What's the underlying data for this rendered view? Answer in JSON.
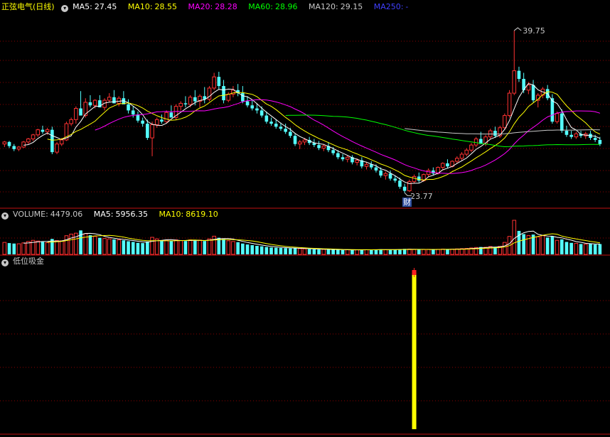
{
  "price": {
    "stock_name": "正弦电气",
    "period": "(日线)",
    "ma": [
      {
        "label": "MA5:",
        "value": "27.45",
        "color": "#ffffff"
      },
      {
        "label": "MA10:",
        "value": "28.55",
        "color": "#ffff00"
      },
      {
        "label": "MA20:",
        "value": "28.28",
        "color": "#ff00ff"
      },
      {
        "label": "MA60:",
        "value": "28.96",
        "color": "#00ff00"
      },
      {
        "label": "MA120:",
        "value": "29.15",
        "color": "#c8c8c8"
      },
      {
        "label": "MA250:",
        "value": "-",
        "color": "#4040ff"
      }
    ],
    "high_label": "39.75",
    "low_label": "23.77",
    "event_marker": "财",
    "ylim": [
      22.5,
      41.5
    ]
  },
  "volume": {
    "title": "VOLUME:",
    "value": "4479.06",
    "ma5_label": "MA5:",
    "ma5_value": "5956.35",
    "ma10_label": "MA10:",
    "ma10_value": "8619.10"
  },
  "indicator": {
    "title": "低位吸金",
    "signal_index": 86
  },
  "colors": {
    "up": "#ff3232",
    "down": "#54ffff",
    "grid": "#8b0000",
    "signal": "#ffff00"
  },
  "chart_data": [
    {
      "type": "candlestick",
      "series": [
        {
          "name": "K",
          "values": [
            [
              28.6,
              28.9,
              28.3,
              28.8
            ],
            [
              28.8,
              28.9,
              28.2,
              28.4
            ],
            [
              28.4,
              28.6,
              27.9,
              28.1
            ],
            [
              28.1,
              28.4,
              27.9,
              28.3
            ],
            [
              28.3,
              28.9,
              28.2,
              28.8
            ],
            [
              28.8,
              29.2,
              28.6,
              29.1
            ],
            [
              29.1,
              29.6,
              28.9,
              29.5
            ],
            [
              29.5,
              30.1,
              29.3,
              30.0
            ],
            [
              30.0,
              30.4,
              29.6,
              29.8
            ],
            [
              29.8,
              30.2,
              29.5,
              30.0
            ],
            [
              30.0,
              30.3,
              27.6,
              27.8
            ],
            [
              27.8,
              28.8,
              27.6,
              28.6
            ],
            [
              28.6,
              29.2,
              28.4,
              29.0
            ],
            [
              29.0,
              30.8,
              28.9,
              30.6
            ],
            [
              30.6,
              31.2,
              30.4,
              31.0
            ],
            [
              31.0,
              32.3,
              30.6,
              32.1
            ],
            [
              32.1,
              33.8,
              31.9,
              31.4
            ],
            [
              31.4,
              33.1,
              31.2,
              32.7
            ],
            [
              32.7,
              33.4,
              32.2,
              32.4
            ],
            [
              32.4,
              33.0,
              32.1,
              32.9
            ],
            [
              32.9,
              33.4,
              32.5,
              32.2
            ],
            [
              32.2,
              33.1,
              31.9,
              32.9
            ],
            [
              32.9,
              33.6,
              32.7,
              33.2
            ],
            [
              33.2,
              33.9,
              32.8,
              32.6
            ],
            [
              32.6,
              33.3,
              32.3,
              33.1
            ],
            [
              33.1,
              33.8,
              32.8,
              32.5
            ],
            [
              32.5,
              33.0,
              31.6,
              31.9
            ],
            [
              31.9,
              32.3,
              31.2,
              31.5
            ],
            [
              31.5,
              31.8,
              30.7,
              30.9
            ],
            [
              30.9,
              31.2,
              30.3,
              30.6
            ],
            [
              30.6,
              31.0,
              29.0,
              29.2
            ],
            [
              29.2,
              30.8,
              27.4,
              30.5
            ],
            [
              30.5,
              31.2,
              30.2,
              31.0
            ],
            [
              31.0,
              31.5,
              30.6,
              30.8
            ],
            [
              30.8,
              31.9,
              30.6,
              31.7
            ],
            [
              31.7,
              32.4,
              31.4,
              31.2
            ],
            [
              31.2,
              32.5,
              31.0,
              32.3
            ],
            [
              32.3,
              32.8,
              31.9,
              32.6
            ],
            [
              32.6,
              33.3,
              32.2,
              32.5
            ],
            [
              32.5,
              33.4,
              32.2,
              33.2
            ],
            [
              33.2,
              33.9,
              32.4,
              32.8
            ],
            [
              32.8,
              33.5,
              32.2,
              33.3
            ],
            [
              33.3,
              34.2,
              32.6,
              33.0
            ],
            [
              33.0,
              34.3,
              32.8,
              34.1
            ],
            [
              34.1,
              35.6,
              33.9,
              35.2
            ],
            [
              35.2,
              35.7,
              34.0,
              34.3
            ],
            [
              34.3,
              34.9,
              32.6,
              32.9
            ],
            [
              32.9,
              33.7,
              32.7,
              33.5
            ],
            [
              33.5,
              34.3,
              33.2,
              33.9
            ],
            [
              33.9,
              34.5,
              33.3,
              33.6
            ],
            [
              33.6,
              34.3,
              32.6,
              32.8
            ],
            [
              32.8,
              33.3,
              32.2,
              32.4
            ],
            [
              32.4,
              32.9,
              31.9,
              32.1
            ],
            [
              32.1,
              32.6,
              31.6,
              31.9
            ],
            [
              31.9,
              32.3,
              31.2,
              31.4
            ],
            [
              31.4,
              31.8,
              30.6,
              30.8
            ],
            [
              30.8,
              31.2,
              30.4,
              30.6
            ],
            [
              30.6,
              31.0,
              30.1,
              30.3
            ],
            [
              30.3,
              30.7,
              29.9,
              30.1
            ],
            [
              30.1,
              30.6,
              29.6,
              29.8
            ],
            [
              29.8,
              30.2,
              29.2,
              29.4
            ],
            [
              29.4,
              29.6,
              28.4,
              28.6
            ],
            [
              28.6,
              29.0,
              28.1,
              28.8
            ],
            [
              28.8,
              29.2,
              28.5,
              29.0
            ],
            [
              29.0,
              29.3,
              28.5,
              28.7
            ],
            [
              28.7,
              29.1,
              28.3,
              28.5
            ],
            [
              28.5,
              28.9,
              28.0,
              28.2
            ],
            [
              28.2,
              28.6,
              27.9,
              28.4
            ],
            [
              28.4,
              28.8,
              27.8,
              28.0
            ],
            [
              28.0,
              28.3,
              27.5,
              27.7
            ],
            [
              27.7,
              28.0,
              27.1,
              27.3
            ],
            [
              27.3,
              27.6,
              26.9,
              27.1
            ],
            [
              27.1,
              27.5,
              26.8,
              27.3
            ],
            [
              27.3,
              27.5,
              26.6,
              26.8
            ],
            [
              26.8,
              27.2,
              26.5,
              27.0
            ],
            [
              27.0,
              27.3,
              26.2,
              26.4
            ],
            [
              26.4,
              26.8,
              26.1,
              26.6
            ],
            [
              26.6,
              26.9,
              26.1,
              26.3
            ],
            [
              26.3,
              26.6,
              25.8,
              26.0
            ],
            [
              26.0,
              26.3,
              25.3,
              25.5
            ],
            [
              25.5,
              25.9,
              25.1,
              25.7
            ],
            [
              25.7,
              26.0,
              25.0,
              25.2
            ],
            [
              25.2,
              25.5,
              24.8,
              25.0
            ],
            [
              25.0,
              25.3,
              24.2,
              24.4
            ],
            [
              24.4,
              24.7,
              23.8,
              24.0
            ],
            [
              24.0,
              25.1,
              23.9,
              24.9
            ],
            [
              24.9,
              25.6,
              24.7,
              25.4
            ],
            [
              25.4,
              25.8,
              24.8,
              25.0
            ],
            [
              25.0,
              25.7,
              24.9,
              25.6
            ],
            [
              25.6,
              26.2,
              25.4,
              26.0
            ],
            [
              26.0,
              26.3,
              25.5,
              25.7
            ],
            [
              25.7,
              26.4,
              25.6,
              26.3
            ],
            [
              26.3,
              26.8,
              26.1,
              26.7
            ],
            [
              26.7,
              27.1,
              26.2,
              26.4
            ],
            [
              26.4,
              27.0,
              26.3,
              26.9
            ],
            [
              26.9,
              27.4,
              26.7,
              27.2
            ],
            [
              27.2,
              27.8,
              27.0,
              27.6
            ],
            [
              27.6,
              28.2,
              27.4,
              28.0
            ],
            [
              28.0,
              28.7,
              27.8,
              28.5
            ],
            [
              28.5,
              29.3,
              28.3,
              29.1
            ],
            [
              29.1,
              29.8,
              28.9,
              28.6
            ],
            [
              28.6,
              29.5,
              28.4,
              29.3
            ],
            [
              29.3,
              30.1,
              29.1,
              29.9
            ],
            [
              29.9,
              30.3,
              29.2,
              29.4
            ],
            [
              29.4,
              30.4,
              29.2,
              30.2
            ],
            [
              30.2,
              31.6,
              30.0,
              31.4
            ],
            [
              31.4,
              33.9,
              31.2,
              33.6
            ],
            [
              33.6,
              39.75,
              33.4,
              35.8
            ],
            [
              35.8,
              36.2,
              34.7,
              35.0
            ],
            [
              35.0,
              35.6,
              33.6,
              33.9
            ],
            [
              33.9,
              34.7,
              33.5,
              34.4
            ],
            [
              34.4,
              34.9,
              32.7,
              32.9
            ],
            [
              32.9,
              33.6,
              32.2,
              33.4
            ],
            [
              33.4,
              34.2,
              33.1,
              34.0
            ],
            [
              34.0,
              34.4,
              32.9,
              33.1
            ],
            [
              33.1,
              33.5,
              30.6,
              30.8
            ],
            [
              30.8,
              31.8,
              30.6,
              31.6
            ],
            [
              31.6,
              32.0,
              29.7,
              29.9
            ],
            [
              29.9,
              30.4,
              29.3,
              29.5
            ],
            [
              29.5,
              29.9,
              29.1,
              29.3
            ],
            [
              29.3,
              29.8,
              29.1,
              29.6
            ],
            [
              29.6,
              29.9,
              29.2,
              29.4
            ],
            [
              29.4,
              29.8,
              29.1,
              29.6
            ],
            [
              29.6,
              29.9,
              29.0,
              29.2
            ],
            [
              29.2,
              29.5,
              28.8,
              29.0
            ],
            [
              29.0,
              29.3,
              28.4,
              28.6
            ]
          ]
        },
        {
          "name": "VOLUME",
          "values": [
            5200,
            4900,
            4700,
            4600,
            5000,
            5600,
            6100,
            5800,
            5400,
            5100,
            6700,
            6000,
            5900,
            8100,
            8800,
            9200,
            10400,
            9000,
            8300,
            7800,
            7200,
            6900,
            6700,
            6500,
            6300,
            6100,
            5700,
            5400,
            5000,
            4900,
            5600,
            7400,
            6700,
            5900,
            6200,
            5700,
            6300,
            6000,
            5800,
            6300,
            5900,
            6200,
            5800,
            6700,
            7900,
            7200,
            6700,
            5900,
            5600,
            5300,
            4700,
            4300,
            4000,
            3700,
            3500,
            3200,
            3000,
            2900,
            2800,
            2700,
            2600,
            2700,
            2500,
            2400,
            2300,
            2200,
            2100,
            2200,
            2100,
            2000,
            2000,
            1900,
            2000,
            1900,
            2000,
            2100,
            2000,
            2000,
            2100,
            2200,
            2000,
            2100,
            2100,
            2200,
            2400,
            2300,
            2100,
            2000,
            2100,
            2200,
            2100,
            2200,
            2300,
            2200,
            2300,
            2400,
            2500,
            2600,
            2800,
            3000,
            3200,
            3100,
            3400,
            3200,
            3500,
            5200,
            7800,
            14800,
            10200,
            8800,
            8200,
            8600,
            7600,
            8100,
            7300,
            7900,
            6100,
            6500,
            5400,
            5000,
            4800,
            4500,
            4400,
            4600,
            4300,
            4479
          ]
        }
      ]
    }
  ]
}
